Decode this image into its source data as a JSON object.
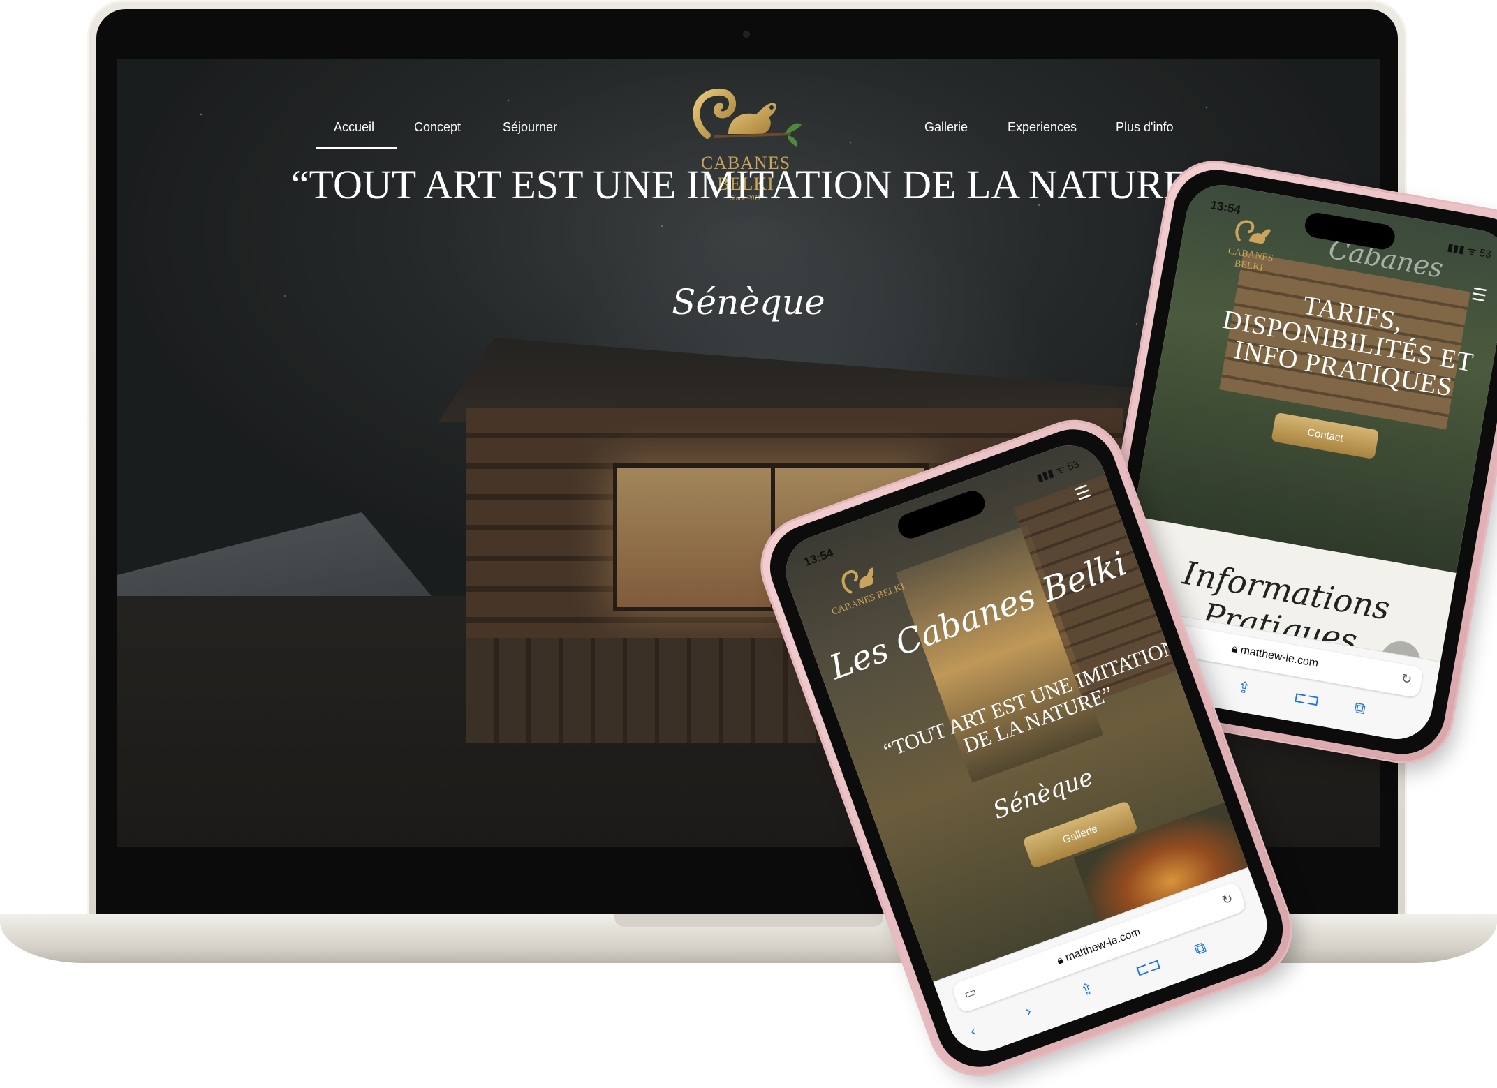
{
  "desktop": {
    "nav_left": [
      "Accueil",
      "Concept",
      "Séjourner"
    ],
    "nav_right": [
      "Gallerie",
      "Experiences",
      "Plus d'info"
    ],
    "active_nav": "Accueil",
    "logo_name": "CABANES BELKI",
    "logo_since": "Since 2017",
    "hero_quote": "“TOUT ART EST UNE IMITATION DE LA NATURE”",
    "hero_author": "Sénèque"
  },
  "phone_right": {
    "time": "13:54",
    "status_icons": "▮▮▮ ᯤ 53",
    "script_title": "Cabanes",
    "logo_name": "CABANES BELKI",
    "title": "TARIFS, DISPONIBILITÉS ET INFO PRATIQUES",
    "contact_button": "Contact",
    "section_title": "Informations Pratiques",
    "url": "matthew-le.com"
  },
  "phone_left": {
    "time": "13:54",
    "status_icons": "▮▮▮ ᯤ 53",
    "logo_name": "CABANES BELKI",
    "script_title": "Les Cabanes Belki",
    "quote": "“TOUT ART EST UNE IMITATION DE LA NATURE”",
    "author": "Sénèque",
    "gallery_button": "Gallerie",
    "url": "matthew-le.com"
  },
  "icons": {
    "menu": "hamburger-icon",
    "back": "chevron-left-icon",
    "forward": "chevron-right-icon",
    "share": "share-icon",
    "bookmarks": "book-icon",
    "tabs": "tabs-icon",
    "reload": "reload-icon",
    "lock": "lock-icon",
    "scroll_top": "chevron-up-icon"
  },
  "colors": {
    "gold": "#c9a45a",
    "phone_frame": "#e6b9bd",
    "link_blue": "#1a73e8"
  }
}
